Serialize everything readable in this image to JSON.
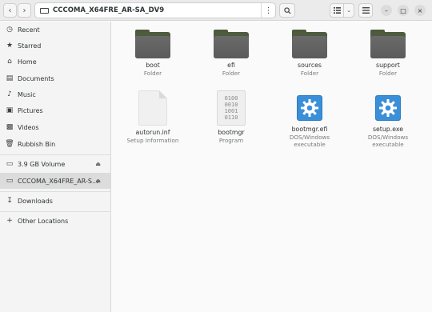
{
  "window": {
    "path": "CCCOMA_X64FRE_AR-SA_DV9"
  },
  "headerbar": {
    "back_icon": "chevron-left-icon",
    "forward_icon": "chevron-right-icon",
    "menu_icon": "vertical-dots-icon",
    "search_icon": "search-icon",
    "view_list_icon": "list-view-icon",
    "view_options_icon": "chevron-down-icon",
    "main_menu_icon": "hamburger-icon",
    "minimize": "–",
    "maximize": "□",
    "close": "×"
  },
  "sidebar": {
    "places": [
      {
        "label": "Recent",
        "icon": "clock-icon"
      },
      {
        "label": "Starred",
        "icon": "star-icon"
      },
      {
        "label": "Home",
        "icon": "home-icon"
      },
      {
        "label": "Documents",
        "icon": "document-icon"
      },
      {
        "label": "Music",
        "icon": "music-icon"
      },
      {
        "label": "Pictures",
        "icon": "picture-icon"
      },
      {
        "label": "Videos",
        "icon": "video-icon"
      },
      {
        "label": "Rubbish Bin",
        "icon": "trash-icon"
      }
    ],
    "devices": [
      {
        "label": "3.9 GB Volume",
        "icon": "drive-icon"
      },
      {
        "label": "CCCOMA_X64FRE_AR-S...",
        "icon": "drive-icon"
      }
    ],
    "downloads": {
      "label": "Downloads",
      "icon": "download-icon"
    },
    "other": {
      "label": "Other Locations",
      "icon": "plus-icon"
    }
  },
  "files": [
    {
      "name": "boot",
      "type": "Folder",
      "kind": "folder"
    },
    {
      "name": "efi",
      "type": "Folder",
      "kind": "folder"
    },
    {
      "name": "sources",
      "type": "Folder",
      "kind": "folder"
    },
    {
      "name": "support",
      "type": "Folder",
      "kind": "folder"
    },
    {
      "name": "autorun.inf",
      "type": "Setup Information",
      "kind": "doc"
    },
    {
      "name": "bootmgr",
      "type": "Program",
      "kind": "binary",
      "glyph": [
        "0100",
        "0010",
        "1001",
        "0110"
      ]
    },
    {
      "name": "bootmgr.efi",
      "type": "DOS/Windows\nexecutable",
      "kind": "exe"
    },
    {
      "name": "setup.exe",
      "type": "DOS/Windows\nexecutable",
      "kind": "exe"
    }
  ]
}
